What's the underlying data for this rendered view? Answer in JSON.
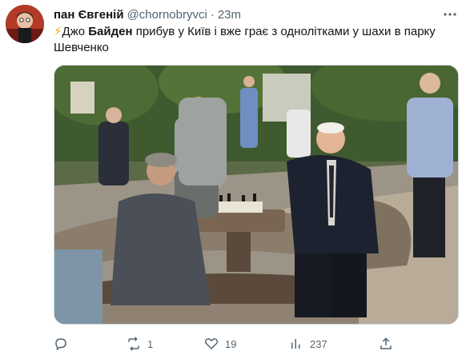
{
  "tweet": {
    "display_name": "пан Євгеній",
    "handle": "@chornobryvci",
    "separator": "·",
    "time": "23m",
    "text_lead_icon": "⚡",
    "text_part1": "Джо ",
    "text_bold": "Байден",
    "text_part2": " прибув у Київ і вже грає з однолітками у шахи в парку Шевченко",
    "media_icon": "photo-image",
    "stats": {
      "replies_icon": "reply-icon",
      "retweets": "1",
      "likes": "19",
      "views": "237"
    }
  },
  "colors": {
    "text_primary": "#0f1419",
    "text_secondary": "#536471",
    "border": "#cfd9de",
    "bolt": "#f5b301"
  }
}
